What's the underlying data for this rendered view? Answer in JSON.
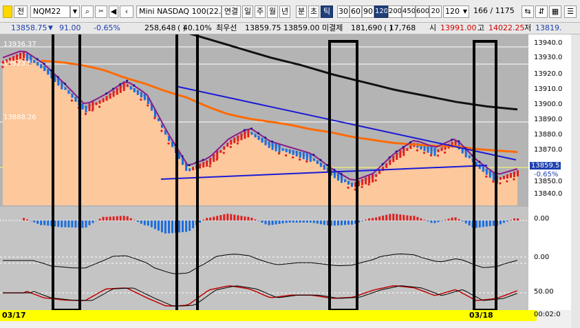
{
  "toolbar": {
    "tab_label": "전",
    "symbol": "NQM22",
    "name": "Mini NASDAQ 100(22.0",
    "link_label": "연결",
    "periods": [
      "일",
      "주",
      "월",
      "년",
      "분",
      "초",
      "틱"
    ],
    "active_period": "틱",
    "intervals": [
      "30",
      "60",
      "90",
      "120",
      "200",
      "450",
      "600",
      "20"
    ],
    "active_interval": "120",
    "interval_select": "120",
    "count": "166",
    "total": "1175"
  },
  "quote": {
    "price": "13858.75",
    "change": "91.00",
    "change_pct": "-0.65%",
    "volume": "258,648",
    "vol_ratio": "40.10%",
    "bid_label": "최우선",
    "bid": "13859.75",
    "ask": "13859.00",
    "open_int_label": "미결제",
    "open_int": "181,690",
    "open_int_chg": "17,768",
    "open_label": "시",
    "open": "13991.00",
    "high_label": "고",
    "high": "14022.25",
    "low_label": "저",
    "low": "13819."
  },
  "chart": {
    "price_axis": [
      "13940.0",
      "13930.0",
      "13920.0",
      "13910.0",
      "13900.0",
      "13890.0",
      "13880.0",
      "13870.0",
      "13860.0",
      "13850.0",
      "13840.0"
    ],
    "current_label": "13859.5",
    "current_pct": "-0.65%",
    "left_labels": [
      "13936.37",
      "13923.5",
      "13888.26"
    ],
    "osc_axis": [
      "0.00",
      "0.00",
      "50.00"
    ],
    "dates": [
      "03/17",
      "03/18"
    ],
    "time_label": "00:02:0"
  },
  "chart_data": {
    "type": "line",
    "title": "",
    "ylim": [
      13835,
      13945
    ],
    "series": [
      {
        "values": [
          13929,
          13934,
          13925,
          13912,
          13898,
          13905,
          13914,
          13905,
          13880,
          13858,
          13863,
          13876,
          13883,
          13874,
          13870,
          13866,
          13856,
          13848,
          13853,
          13866,
          13875,
          13870,
          13876,
          13862,
          13852,
          13856
        ]
      },
      {
        "values": [
          13930,
          13929,
          13927,
          13924,
          13919,
          13915,
          13910,
          13906,
          13900,
          13895,
          13892,
          13890,
          13888,
          13885,
          13883,
          13880,
          13878,
          13876,
          13875,
          13874,
          13874,
          13872,
          13871,
          13870
        ]
      },
      {
        "values": [
          13958,
          13955,
          13950,
          13944,
          13938,
          13932,
          13927,
          13921,
          13916,
          13911,
          13907,
          13903,
          13900,
          13898
        ]
      }
    ]
  }
}
